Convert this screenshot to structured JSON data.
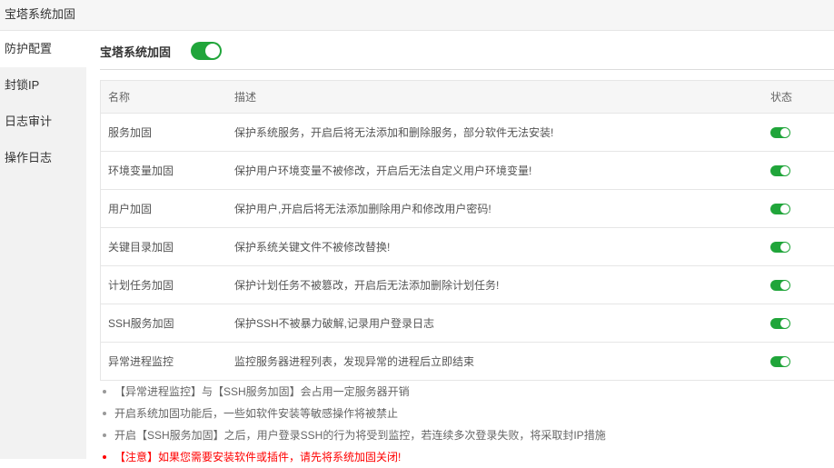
{
  "window": {
    "title": "宝塔系统加固"
  },
  "sidebar": {
    "items": [
      {
        "label": "防护配置",
        "active": true
      },
      {
        "label": "封锁IP",
        "active": false
      },
      {
        "label": "日志审计",
        "active": false
      },
      {
        "label": "操作日志",
        "active": false
      }
    ]
  },
  "main": {
    "header_label": "宝塔系统加固",
    "master_switch": {
      "on": true
    }
  },
  "table": {
    "headers": {
      "name": "名称",
      "desc": "描述",
      "status": "状态"
    },
    "rows": [
      {
        "name": "服务加固",
        "desc": "保护系统服务，开启后将无法添加和删除服务，部分软件无法安装!",
        "on": true
      },
      {
        "name": "环境变量加固",
        "desc": "保护用户环境变量不被修改，开启后无法自定义用户环境变量!",
        "on": true
      },
      {
        "name": "用户加固",
        "desc": "保护用户,开启后将无法添加删除用户和修改用户密码!",
        "on": true
      },
      {
        "name": "关键目录加固",
        "desc": "保护系统关键文件不被修改替换!",
        "on": true
      },
      {
        "name": "计划任务加固",
        "desc": "保护计划任务不被篡改，开启后无法添加删除计划任务!",
        "on": true
      },
      {
        "name": "SSH服务加固",
        "desc": "保护SSH不被暴力破解,记录用户登录日志",
        "on": true
      },
      {
        "name": "异常进程监控",
        "desc": "监控服务器进程列表，发现异常的进程后立即结束",
        "on": true
      }
    ]
  },
  "notes": [
    {
      "text": "【异常进程监控】与【SSH服务加固】会占用一定服务器开销",
      "warn": false
    },
    {
      "text": "开启系统加固功能后，一些如软件安装等敏感操作将被禁止",
      "warn": false
    },
    {
      "text": "开启【SSH服务加固】之后，用户登录SSH的行为将受到监控，若连续多次登录失败，将采取封IP措施",
      "warn": false
    },
    {
      "text": "【注意】如果您需要安装软件或插件，请先将系统加固关闭!",
      "warn": true
    }
  ],
  "colors": {
    "accent": "#20a53a",
    "warning": "#ff0000"
  }
}
